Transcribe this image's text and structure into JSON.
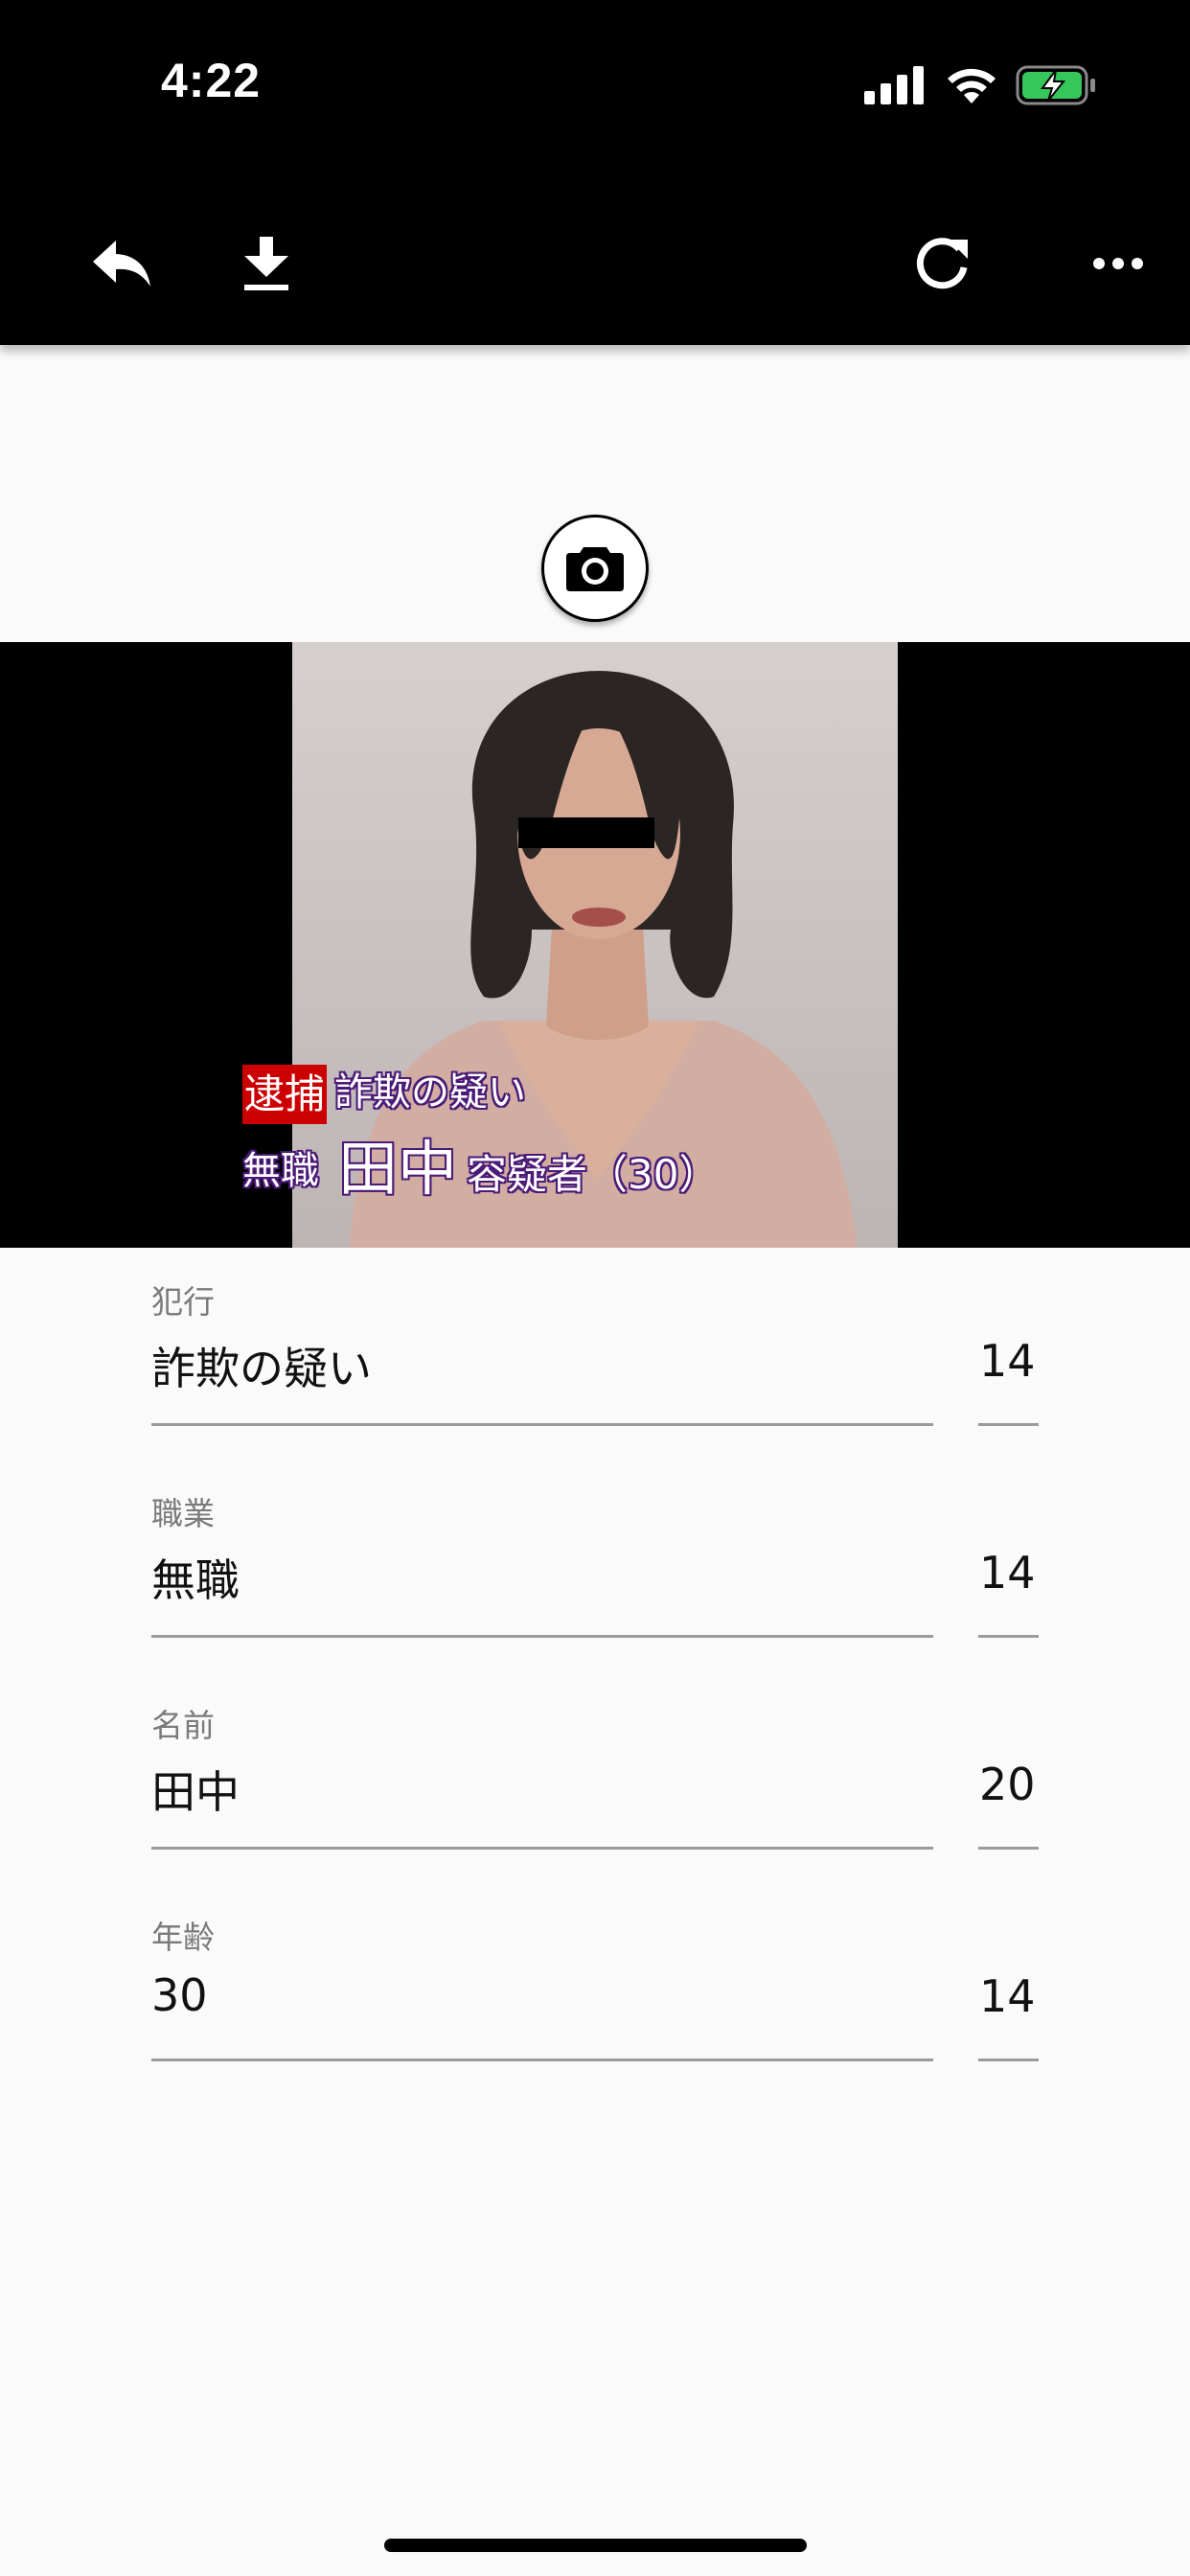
{
  "status_bar": {
    "time": "4:22"
  },
  "toolbar": {
    "back_icon": "reply-icon",
    "download_icon": "download-icon",
    "refresh_icon": "refresh-icon",
    "more_icon": "more-horizontal-icon"
  },
  "camera_button": {
    "icon": "camera-icon"
  },
  "caption": {
    "tag": "逮捕",
    "crime": "詐欺の疑い",
    "occupation": "無職",
    "name": "田中",
    "suffix": "容疑者（30）"
  },
  "form": {
    "fields": [
      {
        "label": "犯行",
        "value": "詐欺の疑い",
        "count": "14"
      },
      {
        "label": "職業",
        "value": "無職",
        "count": "14"
      },
      {
        "label": "名前",
        "value": "田中",
        "count": "20"
      },
      {
        "label": "年齢",
        "value": "30",
        "count": "14"
      }
    ]
  }
}
